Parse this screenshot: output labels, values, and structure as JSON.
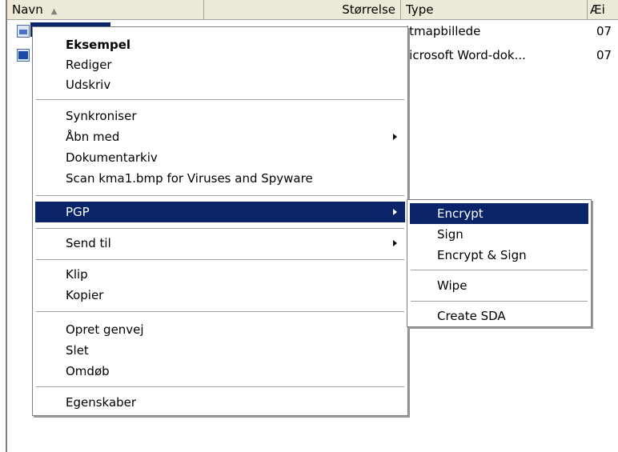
{
  "columns": {
    "name": "Navn",
    "size": "Størrelse",
    "type": "Type",
    "modified": "Æi"
  },
  "files": [
    {
      "icon": "bitmap-file-icon",
      "type": "itmapbillede",
      "modified": "07"
    },
    {
      "icon": "word-document-icon",
      "type": "licrosoft Word-dok...",
      "modified": "07"
    }
  ],
  "context_menu": {
    "items": [
      {
        "label": "Eksempel",
        "bold": true
      },
      {
        "label": "Rediger"
      },
      {
        "label": "Udskriv"
      },
      {
        "label": "Synkroniser"
      },
      {
        "label": "Åbn med",
        "submenu": true
      },
      {
        "label": "Dokumentarkiv"
      },
      {
        "label": "Scan kma1.bmp for Viruses and Spyware"
      },
      {
        "label": "PGP",
        "submenu": true,
        "highlighted": true
      },
      {
        "label": "Send til",
        "submenu": true
      },
      {
        "label": "Klip"
      },
      {
        "label": "Kopier"
      },
      {
        "label": "Opret genvej"
      },
      {
        "label": "Slet"
      },
      {
        "label": "Omdøb"
      },
      {
        "label": "Egenskaber"
      }
    ]
  },
  "pgp_submenu": {
    "items": [
      {
        "label": "Encrypt",
        "highlighted": true
      },
      {
        "label": "Sign"
      },
      {
        "label": "Encrypt & Sign"
      },
      {
        "label": "Wipe"
      },
      {
        "label": "Create SDA"
      }
    ]
  },
  "colors": {
    "highlight": "#0a246a",
    "header_bg": "#ece9d8"
  }
}
